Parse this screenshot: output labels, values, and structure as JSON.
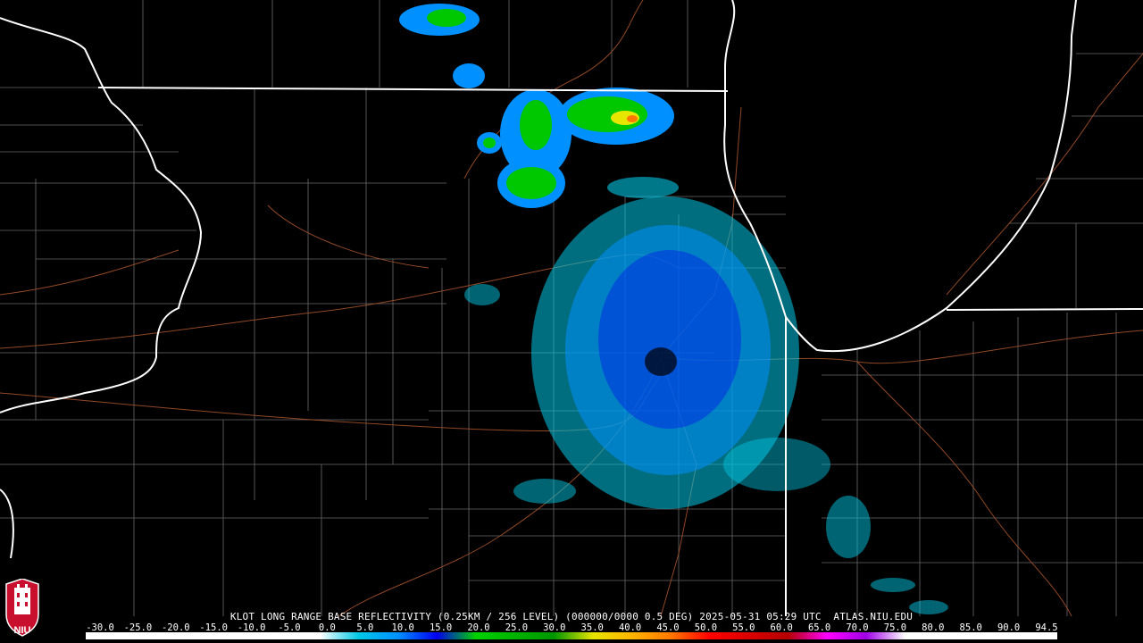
{
  "caption": {
    "radar_id": "KLOT",
    "product": "LONG RANGE BASE REFLECTIVITY",
    "resolution": "(0.25KM / 256 LEVEL)",
    "volume": "(000000/0000 0.5 DEG)",
    "date": "2025-05-31",
    "time": "05:29 UTC",
    "source": "ATLAS.NIU.EDU"
  },
  "logo": {
    "text": "NIU",
    "icon": "niu-tower-logo-icon"
  },
  "legend": {
    "labels": [
      "-30.0",
      "-25.0",
      "-20.0",
      "-15.0",
      "-10.0",
      "-5.0",
      "0.0",
      "5.0",
      "10.0",
      "15.0",
      "20.0",
      "25.0",
      "30.0",
      "35.0",
      "40.0",
      "45.0",
      "50.0",
      "55.0",
      "60.0",
      "65.0",
      "70.0",
      "75.0",
      "80.0",
      "85.0",
      "90.0",
      "94.5"
    ],
    "stops": [
      {
        "value": -30,
        "color": "#ffffff"
      },
      {
        "value": 0,
        "color": "#ffffff"
      },
      {
        "value": 5,
        "color": "#00c8e6"
      },
      {
        "value": 10,
        "color": "#0090ff"
      },
      {
        "value": 15,
        "color": "#0000f0"
      },
      {
        "value": 20,
        "color": "#00d200"
      },
      {
        "value": 25,
        "color": "#00b400"
      },
      {
        "value": 30,
        "color": "#009600"
      },
      {
        "value": 35,
        "color": "#e6e600"
      },
      {
        "value": 40,
        "color": "#ffb400"
      },
      {
        "value": 45,
        "color": "#ff7800"
      },
      {
        "value": 50,
        "color": "#ff0000"
      },
      {
        "value": 55,
        "color": "#dc0000"
      },
      {
        "value": 60,
        "color": "#b40000"
      },
      {
        "value": 65,
        "color": "#ff00ff"
      },
      {
        "value": 70,
        "color": "#a000e6"
      },
      {
        "value": 75,
        "color": "#ffffff"
      },
      {
        "value": 94.5,
        "color": "#ffffff"
      }
    ]
  },
  "colors": {
    "background": "#000000",
    "state_border": "#ffffff",
    "county_border": "#8c8c8c",
    "highway": "#a0502a",
    "echo_light": "#00c8e6",
    "echo_mid": "#0090ff",
    "echo_heavy": "#0000f0",
    "echo_green": "#00c800",
    "echo_yellow": "#e6e600"
  }
}
